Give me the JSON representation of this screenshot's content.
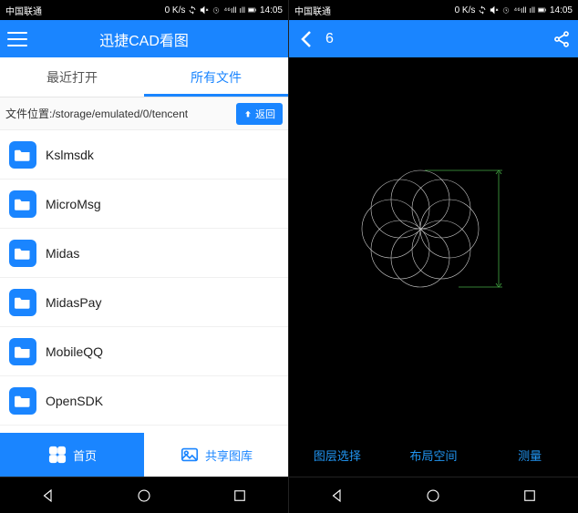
{
  "statusbar": {
    "carrier": "中国联通",
    "speed": "0 K/s",
    "time": "14:05"
  },
  "left": {
    "title": "迅捷CAD看图",
    "tabs": {
      "recent": "最近打开",
      "all": "所有文件"
    },
    "path_prefix": "文件位置:",
    "path": "/storage/emulated/0/tencent",
    "back_label": "返回",
    "files": [
      {
        "name": "Kslmsdk"
      },
      {
        "name": "MicroMsg"
      },
      {
        "name": "Midas"
      },
      {
        "name": "MidasPay"
      },
      {
        "name": "MobileQQ"
      },
      {
        "name": "OpenSDK"
      }
    ],
    "bottom": {
      "home": "首页",
      "gallery": "共享图库"
    }
  },
  "right": {
    "title": "6",
    "bottom": {
      "layer": "图层选择",
      "layout": "布局空间",
      "measure": "测量"
    }
  }
}
